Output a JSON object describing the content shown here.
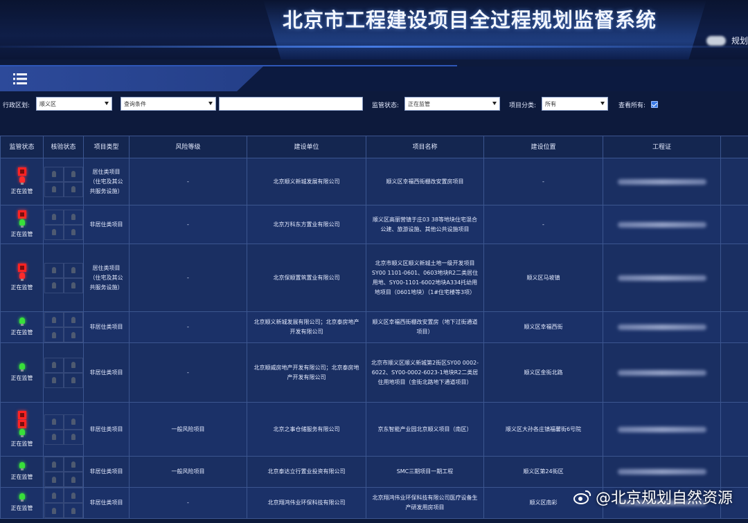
{
  "header": {
    "title": "北京市工程建设项目全过程规划监督系统",
    "user_label": "规划"
  },
  "filters": {
    "district_label": "行政区划:",
    "district_value": "顺义区",
    "query_condition_value": "查询条件",
    "search_value": "",
    "supervision_label": "监管状态:",
    "supervision_value": "正在监管",
    "category_label": "项目分类:",
    "category_value": "所有",
    "view_all_label": "查看所有:"
  },
  "table": {
    "columns": [
      "监管状态",
      "核验状态",
      "项目类型",
      "风险等级",
      "建设单位",
      "项目名称",
      "建设位置",
      "工程证"
    ],
    "rows": [
      {
        "status_icons": [
          "flag",
          "red"
        ],
        "status": "正在监管",
        "type": "居住类项目（住宅及其公共服务设施）",
        "risk": "-",
        "unit": "北京顺义新城发展有限公司",
        "name": "顺义区幸福西街棚改安置房项目",
        "location": "-"
      },
      {
        "status_icons": [
          "flag",
          "green"
        ],
        "status": "正在监管",
        "type": "非居住类项目",
        "risk": "-",
        "unit": "北京万科东方置业有限公司",
        "name": "顺义区高丽营镇于庄03 38等地块住宅混合公建、旅游设施、其他公共设施项目",
        "location": "-"
      },
      {
        "status_icons": [
          "flag",
          "red"
        ],
        "status": "正在监管",
        "type": "居住类项目（住宅及其公共服务设施）",
        "risk": "-",
        "unit": "北京保顺置筑置业有限公司",
        "name": "北京市顺义区顺义新城土地一级开发项目SY00 1101-0601、0603地块R2二类居住用地、SY00-1101-6002地块A334托幼用地项目（0601地块）（1#住宅楼等3项）",
        "location": "顺义区马坡镇"
      },
      {
        "status_icons": [
          "green"
        ],
        "status": "正在监管",
        "type": "非居住类项目",
        "risk": "-",
        "unit": "北京顺义新城发展有限公司；北京泰房地产开发有限公司",
        "name": "顺义区幸福西街棚改安置房（地下过街通道项目）",
        "location": "顺义区幸福西街"
      },
      {
        "status_icons": [
          "green"
        ],
        "status": "正在监管",
        "type": "非居住类项目",
        "risk": "-",
        "unit": "北京顺威房地产开发有限公司；北京泰房地产开发有限公司",
        "name": "北京市顺义区顺义新城第2街区SY00 0002-6022、SY00-0002-6023-1地块R2二类居住用地项目（金街北路地下通道项目）",
        "location": "顺义区金街北路"
      },
      {
        "status_icons": [
          "flag",
          "flag",
          "green"
        ],
        "status": "正在监管",
        "type": "非居住类项目",
        "risk": "一般风险项目",
        "unit": "北京之事仓储服务有限公司",
        "name": "京东智能产业园北京顺义项目（南区）",
        "location": "顺义区大孙各庄镇福馨街6号院"
      },
      {
        "status_icons": [
          "green"
        ],
        "status": "正在监管",
        "type": "非居住类项目",
        "risk": "一般风险项目",
        "unit": "北京泰达立行置业投资有限公司",
        "name": "SMC三期项目一期工程",
        "location": "顺义区第24街区"
      },
      {
        "status_icons": [
          "green"
        ],
        "status": "正在监管",
        "type": "非居住类项目",
        "risk": "-",
        "unit": "北京翔鸿伟业环保科技有限公司",
        "name": "北京翔鸿伟业环保科技有限公司医疗设备生产研发用房项目",
        "location": "顺义区南彩"
      }
    ]
  },
  "watermark": "@北京规划自然资源",
  "colors": {
    "background": "#0d1a3c",
    "header_blue": "#2d4a9a",
    "status_red": "#ff2b2b",
    "status_green": "#38e03a"
  },
  "icons": {
    "menu": "menu-icon",
    "flag": "flag-icon",
    "light": "traffic-light-icon"
  }
}
